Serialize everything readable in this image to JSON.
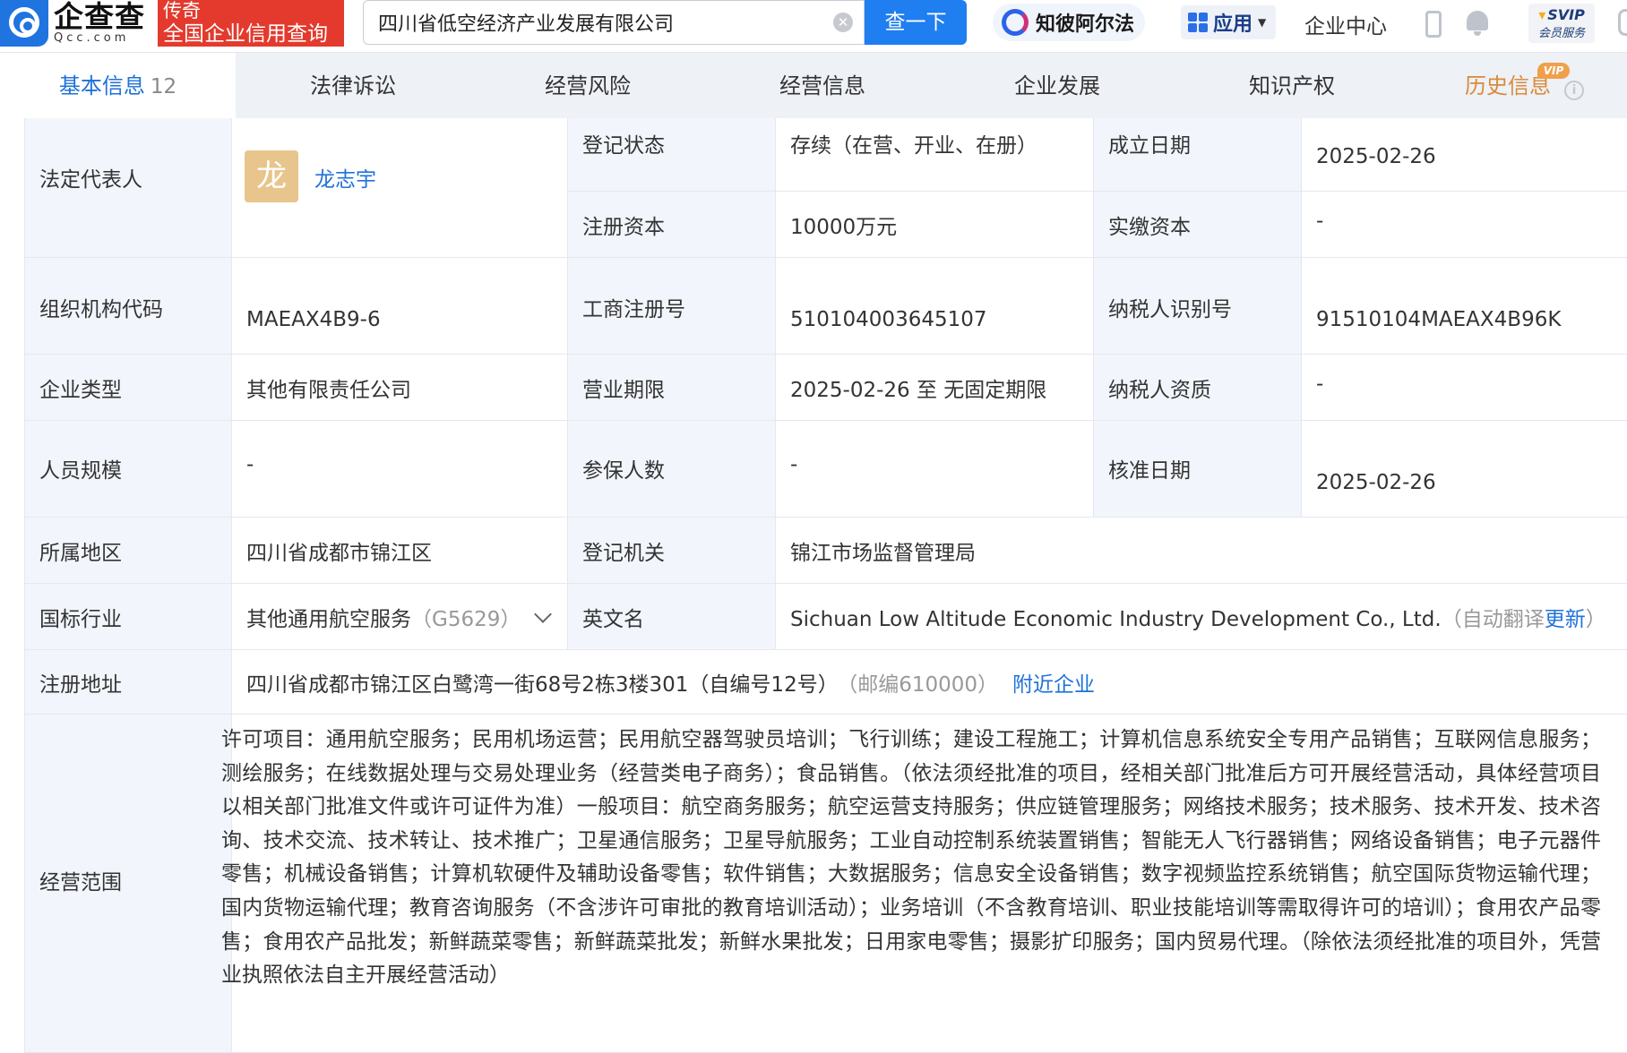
{
  "header": {
    "logo_cn": "企查查",
    "logo_en": "Qcc.com",
    "promo_line1": "传奇",
    "promo_line2": "全国企业信用查询",
    "search_value": "四川省低空经济产业发展有限公司",
    "search_button": "查一下",
    "zhibi_label": "知彼阿尔法",
    "apps_label": "应用",
    "enterprise_center": "企业中心",
    "vip_line1": "SVIP",
    "vip_line2": "会员服务"
  },
  "tabs": [
    {
      "label": "基本信息",
      "count": "12"
    },
    {
      "label": "法律诉讼"
    },
    {
      "label": "经营风险"
    },
    {
      "label": "经营信息"
    },
    {
      "label": "企业发展"
    },
    {
      "label": "知识产权"
    },
    {
      "label": "历史信息"
    }
  ],
  "tab_vip_tag": "VIP",
  "company": {
    "legal_rep_label": "法定代表人",
    "legal_rep_avatar": "龙",
    "legal_rep_name": "龙志宇",
    "reg_status_label": "登记状态",
    "reg_status": "存续（在营、开业、在册）",
    "founded_label": "成立日期",
    "founded": "2025-02-26",
    "reg_capital_label": "注册资本",
    "reg_capital": "10000万元",
    "paid_capital_label": "实缴资本",
    "paid_capital": "-",
    "org_code_label": "组织机构代码",
    "org_code": "MAEAX4B9-6",
    "biz_reg_no_label": "工商注册号",
    "biz_reg_no": "510104003645107",
    "taxpayer_id_label": "纳税人识别号",
    "taxpayer_id": "91510104MAEAX4B96K",
    "company_type_label": "企业类型",
    "company_type": "其他有限责任公司",
    "biz_term_label": "营业期限",
    "biz_term": "2025-02-26 至 无固定期限",
    "taxpayer_qual_label": "纳税人资质",
    "taxpayer_qual": "-",
    "staff_size_label": "人员规模",
    "staff_size": "-",
    "insured_label": "参保人数",
    "insured": "-",
    "approval_date_label": "核准日期",
    "approval_date": "2025-02-26",
    "region_label": "所属地区",
    "region": "四川省成都市锦江区",
    "authority_label": "登记机关",
    "authority": "锦江市场监督管理局",
    "industry_label": "国标行业",
    "industry": "其他通用航空服务",
    "industry_code": "（G5629）",
    "english_name_label": "英文名",
    "english_name": "Sichuan Low Altitude Economic Industry Development Co., Ltd.",
    "english_name_note_a": "（自动翻译",
    "english_name_update": "更新",
    "english_name_note_b": "）",
    "address_label": "注册地址",
    "address": "四川省成都市锦江区白鹭湾一街68号2栋3楼301（自编号12号）",
    "postcode": "（邮编610000）",
    "nearby_link": "附近企业",
    "scope_label": "经营范围",
    "scope": "许可项目：通用航空服务；民用机场运营；民用航空器驾驶员培训；飞行训练；建设工程施工；计算机信息系统安全专用产品销售；互联网信息服务；测绘服务；在线数据处理与交易处理业务（经营类电子商务）；食品销售。（依法须经批准的项目，经相关部门批准后方可开展经营活动，具体经营项目以相关部门批准文件或许可证件为准）一般项目：航空商务服务；航空运营支持服务；供应链管理服务；网络技术服务；技术服务、技术开发、技术咨询、技术交流、技术转让、技术推广；卫星通信服务；卫星导航服务；工业自动控制系统装置销售；智能无人飞行器销售；网络设备销售；电子元器件零售；机械设备销售；计算机软硬件及辅助设备零售；软件销售；大数据服务；信息安全设备销售；数字视频监控系统销售；航空国际货物运输代理；国内货物运输代理；教育咨询服务（不含涉许可审批的教育培训活动）；业务培训（不含教育培训、职业技能培训等需取得许可的培训）；食用农产品零售；食用农产品批发；新鲜蔬菜零售；新鲜蔬菜批发；新鲜水果批发；日用家电零售；摄影扩印服务；国内贸易代理。（除依法须经批准的项目外，凭营业执照依法自主开展经营活动）"
  },
  "colors": {
    "brand_blue": "#1f7ef0",
    "promo_red": "#e33a2d",
    "link_blue": "#1f72d8",
    "label_bg": "#f2f6fc",
    "history_orange": "#d98a3a"
  },
  "icons": [
    "qcc-logo-icon",
    "clear-icon",
    "zhibi-icon",
    "apps-grid-icon",
    "phone-icon",
    "bell-icon",
    "info-icon",
    "chevron-down-icon"
  ]
}
